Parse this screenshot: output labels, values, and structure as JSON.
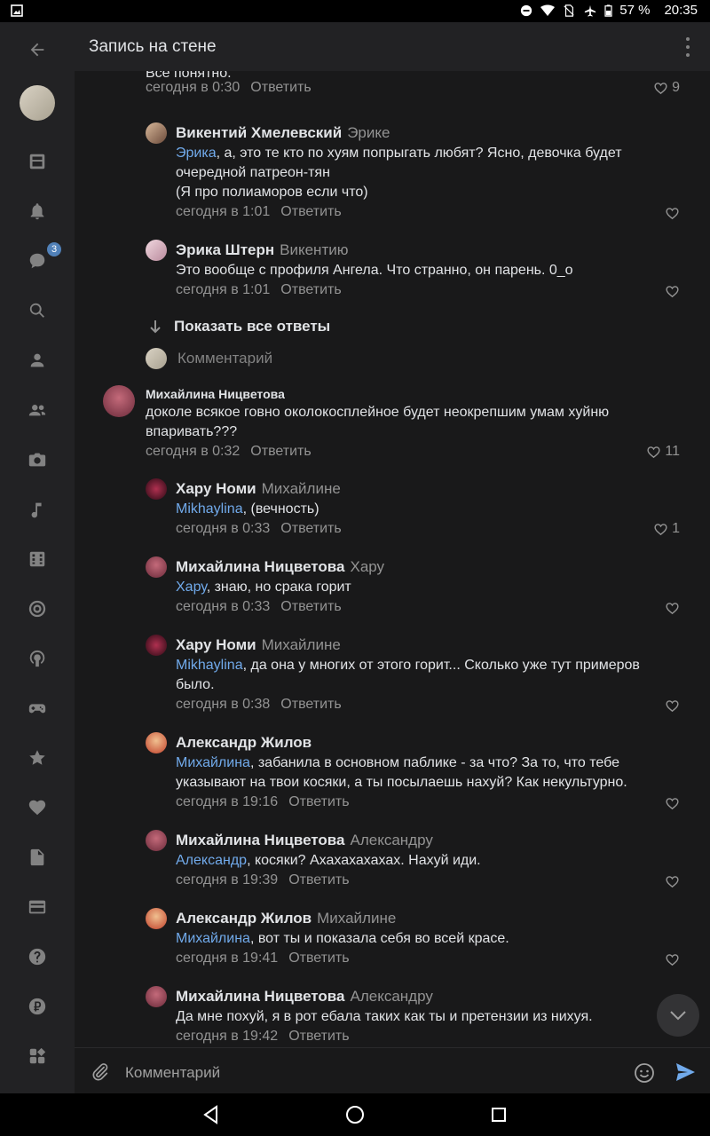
{
  "status_bar": {
    "battery": "57 %",
    "time": "20:35"
  },
  "header": {
    "title": "Запись на стене"
  },
  "sidebar": {
    "badge_count": "3"
  },
  "comments": [
    {
      "text": "Все понятно.",
      "time": "сегодня в 0:30",
      "reply": "Ответить",
      "likes": "9"
    },
    {
      "name": "Викентий Хмелевский",
      "to": "Эрике",
      "mention": "Эрика",
      "text_line1": ", а, это те кто по хуям попрыгать любят? Ясно, девочка будет",
      "text_line2": "очередной патреон-тян",
      "text_line3": "(Я про полиаморов если что)",
      "time": "сегодня в 1:01",
      "reply": "Ответить"
    },
    {
      "name": "Эрика Штерн",
      "to": "Викентию",
      "text": "Это вообще с профиля Ангела. Что странно, он парень. 0_о",
      "time": "сегодня в 1:01",
      "reply": "Ответить"
    },
    {
      "name": "Михайлина Ницветова",
      "text": "доколе всякое говно околокосплейное будет неокрепшим умам хуйню впаривать???",
      "time": "сегодня в 0:32",
      "reply": "Ответить",
      "likes": "11"
    },
    {
      "name": "Хару Номи",
      "to": "Михайлине",
      "mention": "Mikhaylina",
      "text": ", (вечность)",
      "time": "сегодня в 0:33",
      "reply": "Ответить",
      "likes": "1"
    },
    {
      "name": "Михайлина Ницветова",
      "to": "Хару",
      "mention": "Хару",
      "text": ", знаю, но срака горит",
      "time": "сегодня в 0:33",
      "reply": "Ответить"
    },
    {
      "name": "Хару Номи",
      "to": "Михайлине",
      "mention": "Mikhaylina",
      "text_line1": ", да она у многих от этого горит... Сколько уже тут примеров",
      "text_line2": "было.",
      "time": "сегодня в 0:38",
      "reply": "Ответить"
    },
    {
      "name": "Александр Жилов",
      "mention": "Михайлина",
      "text_line1": ", забанила в основном паблике - за что? За то, что тебе",
      "text_line2": "указывают на твои косяки, а ты посылаешь нахуй? Как некультурно.",
      "time": "сегодня в 19:16",
      "reply": "Ответить"
    },
    {
      "name": "Михайлина Ницветова",
      "to": "Александру",
      "mention": "Александр",
      "text": ", косяки? Ахахахахахах. Нахуй иди.",
      "time": "сегодня в 19:39",
      "reply": "Ответить"
    },
    {
      "name": "Александр Жилов",
      "to": "Михайлине",
      "mention": "Михайлина",
      "text": ", вот ты и показала себя во всей красе.",
      "time": "сегодня в 19:41",
      "reply": "Ответить"
    },
    {
      "name": "Михайлина Ницветова",
      "to": "Александру",
      "text": "Да мне похуй, я в рот ебала таких как ты и претензии из нихуя.",
      "time": "сегодня в 19:42",
      "reply": "Ответить"
    }
  ],
  "show_all_replies": "Показать все ответы",
  "inline_comment_placeholder": "Комментарий",
  "composer": {
    "placeholder": "Комментарий"
  },
  "colors": {
    "background": "#19191a",
    "sidebar": "#222224",
    "accent": "#71aaeb",
    "badge": "#5181b8",
    "secondary_text": "#939393"
  }
}
